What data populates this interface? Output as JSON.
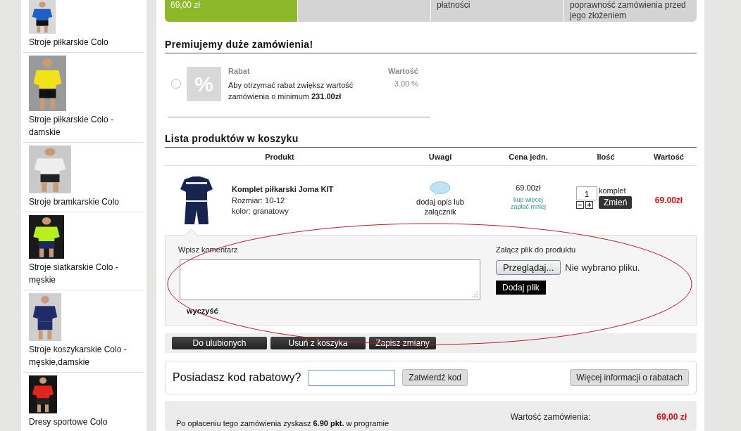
{
  "sidebar": {
    "categories": [
      {
        "label": "Stroje piłkarskie Colo"
      },
      {
        "label": "Stroje piłkarskie Colo - damskie"
      },
      {
        "label": "Stroje bramkarskie Colo"
      },
      {
        "label": "Stroje siatkarskie Colo - męskie"
      },
      {
        "label": "Stroje koszykarskie Colo - męskie,damskie"
      },
      {
        "label": "Dresy sportowe Colo"
      }
    ]
  },
  "steps": [
    {
      "text": "69,00 zł",
      "done": true
    },
    {
      "done": false
    },
    {
      "text": "płatności",
      "done": false
    },
    {
      "text": "poprawność zamówienia przed jego złożeniem",
      "done": false
    }
  ],
  "promo": {
    "title": "Premiujemy duże zamówienia!",
    "options": [
      {
        "selected": false,
        "icon_text": "%",
        "name_header": "Rabat",
        "value_header": "Wartość",
        "description": "Aby otrzymać rabat zwiększ wartość zamówienia o minimum **231.00zł**",
        "value": "3.00 %"
      }
    ]
  },
  "cart": {
    "title": "Lista produktów w koszyku",
    "columns": [
      "Produkt",
      "Uwagi",
      "Cena jedn.",
      "Ilość",
      "Wartość"
    ],
    "rows": [
      {
        "name": "Komplet piłkarski Joma KIT",
        "details": [
          "Rozmiar: 10-12",
          "kolor: granatowy"
        ],
        "note_link": "dodaj opis lub załącznik",
        "price": "69.00zł",
        "price_link": "kup więcej zapłać mniej",
        "quantity": "1",
        "unit": "komplet",
        "minus": "−",
        "plus": "+",
        "change_button": "Zmień",
        "total": "69.00zł"
      }
    ]
  },
  "comment_panel": {
    "comment_label": "Wpisz komentarz",
    "clear_link": "wyczyść",
    "file_label": "Załącz plik do produktu",
    "browse_button": "Przeglądaj...",
    "file_status": "Nie wybrano pliku.",
    "add_file_button": "Dodaj plik"
  },
  "actions": [
    "Do ulubionych",
    "Usuń z koszyka",
    "Zapisz zmiany"
  ],
  "coupon": {
    "label": "Posiadasz kod rabatowy?",
    "submit_button": "Zatwierdź kod",
    "info_button": "Więcej informacji o rabatach"
  },
  "summary": {
    "points_text": "Po opłaceniu tego zamówienia zyskasz **6.90 pkt.** w programie",
    "order_value_label": "Wartość zamówienia:",
    "order_value": "69,00 zł"
  },
  "annotation": {
    "kind": "ellipse"
  }
}
